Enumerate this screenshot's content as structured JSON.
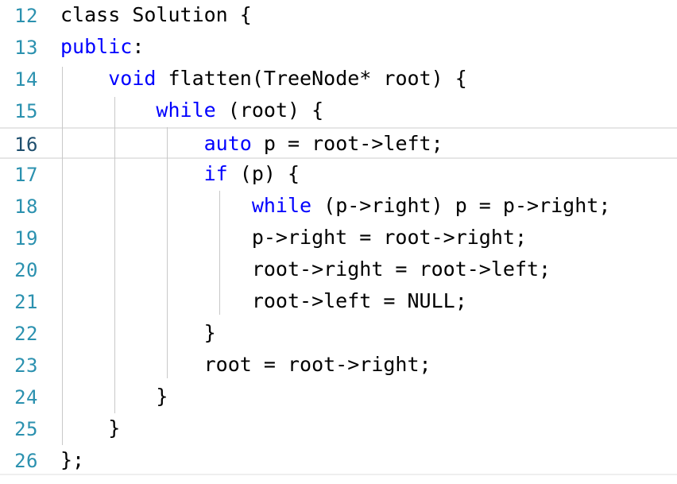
{
  "editor": {
    "colors": {
      "line_number": "#2b91af",
      "keyword": "#0000ff",
      "text": "#000000",
      "guide": "#c8c8c8",
      "current_line_border": "#e6e6e6"
    },
    "lines": [
      {
        "number": "12",
        "segments": [
          {
            "text": "class",
            "type": "kw-plain"
          },
          {
            "text": " Solution {",
            "type": "plain"
          }
        ]
      },
      {
        "number": "13",
        "segments": [
          {
            "text": "public",
            "type": "kw"
          },
          {
            "text": ":",
            "type": "plain"
          }
        ]
      },
      {
        "number": "14",
        "segments": [
          {
            "text": "    ",
            "type": "plain"
          },
          {
            "text": "void",
            "type": "kw"
          },
          {
            "text": " flatten(TreeNode* root) {",
            "type": "plain"
          }
        ]
      },
      {
        "number": "15",
        "segments": [
          {
            "text": "        ",
            "type": "plain"
          },
          {
            "text": "while",
            "type": "kw"
          },
          {
            "text": " (root) {",
            "type": "plain"
          }
        ]
      },
      {
        "number": "16",
        "segments": [
          {
            "text": "            ",
            "type": "plain"
          },
          {
            "text": "auto",
            "type": "kw"
          },
          {
            "text": " p = root->left;",
            "type": "plain"
          }
        ]
      },
      {
        "number": "17",
        "segments": [
          {
            "text": "            ",
            "type": "plain"
          },
          {
            "text": "if",
            "type": "kw"
          },
          {
            "text": " (p) {",
            "type": "plain"
          }
        ]
      },
      {
        "number": "18",
        "segments": [
          {
            "text": "                ",
            "type": "plain"
          },
          {
            "text": "while",
            "type": "kw"
          },
          {
            "text": " (p->right) p = p->right;",
            "type": "plain"
          }
        ]
      },
      {
        "number": "19",
        "segments": [
          {
            "text": "                p->right = root->right;",
            "type": "plain"
          }
        ]
      },
      {
        "number": "20",
        "segments": [
          {
            "text": "                root->right = root->left;",
            "type": "plain"
          }
        ]
      },
      {
        "number": "21",
        "segments": [
          {
            "text": "                root->left = NULL;",
            "type": "plain"
          }
        ]
      },
      {
        "number": "22",
        "segments": [
          {
            "text": "            }",
            "type": "plain"
          }
        ]
      },
      {
        "number": "23",
        "segments": [
          {
            "text": "            root = root->right;",
            "type": "plain"
          }
        ]
      },
      {
        "number": "24",
        "segments": [
          {
            "text": "        }",
            "type": "plain"
          }
        ]
      },
      {
        "number": "25",
        "segments": [
          {
            "text": "    }",
            "type": "plain"
          }
        ]
      },
      {
        "number": "26",
        "segments": [
          {
            "text": "};",
            "type": "plain"
          }
        ]
      }
    ],
    "current_line": "16"
  }
}
